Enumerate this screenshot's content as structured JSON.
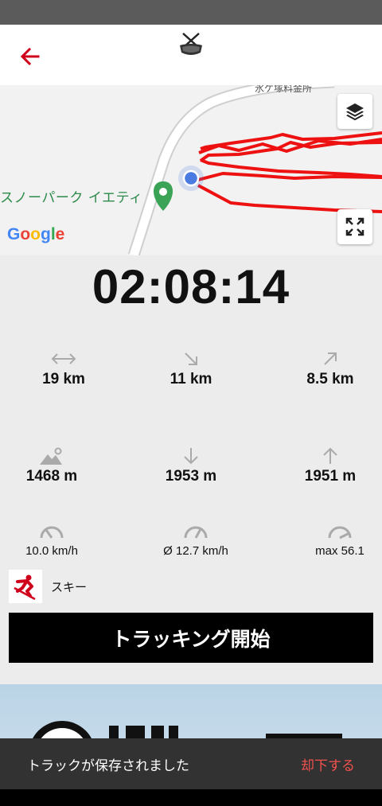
{
  "map": {
    "facility_label": "氷ケ塚料金所",
    "poi_label": "スノーパーク イエティ",
    "attribution": "Google",
    "attribution_colors": [
      "#4285F4",
      "#EA4335",
      "#FBBC05",
      "#4285F4",
      "#34A853",
      "#EA4335"
    ]
  },
  "timer": "02:08:14",
  "stats": {
    "distance": "19 km",
    "downhill_distance": "11 km",
    "uphill_distance": "8.5 km",
    "altitude": "1468 m",
    "descent": "1953 m",
    "ascent": "1951 m",
    "speed": "10.0 km/h",
    "avg_speed": "Ø 12.7 km/h",
    "max_speed": "max 56.1"
  },
  "sport": {
    "label": "スキー",
    "icon": "skier-icon"
  },
  "tracking_button": "トラッキング開始",
  "snackbar": {
    "message": "トラックが保存されました",
    "action": "却下する"
  },
  "colors": {
    "accent": "#d0021b",
    "track": "#ee1111",
    "button_bg": "#000000",
    "snackbar_action": "#f0514e"
  }
}
